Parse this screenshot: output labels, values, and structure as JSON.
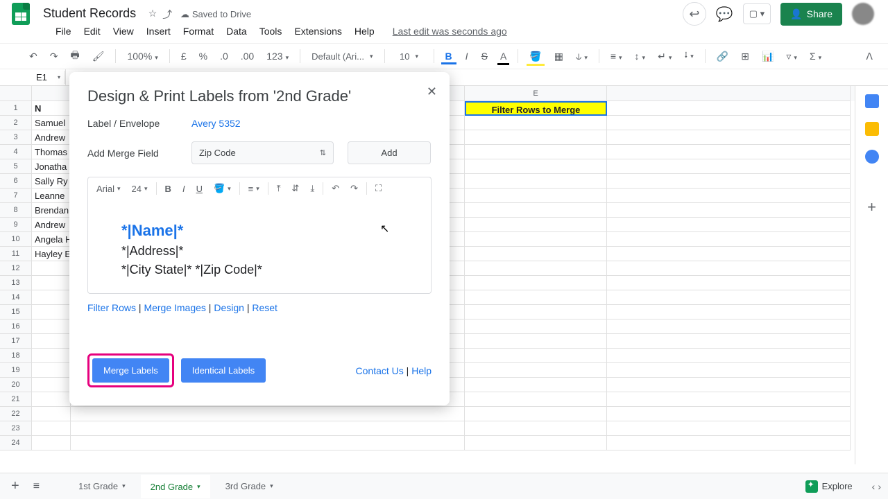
{
  "doc": {
    "title": "Student Records",
    "saved": "Saved to Drive",
    "last_edit": "Last edit was seconds ago"
  },
  "menu": {
    "file": "File",
    "edit": "Edit",
    "view": "View",
    "insert": "Insert",
    "format": "Format",
    "data": "Data",
    "tools": "Tools",
    "extensions": "Extensions",
    "help": "Help"
  },
  "share": "Share",
  "toolbar": {
    "zoom": "100%",
    "currency": "£",
    "percent": "%",
    "dec_dec": ".0",
    "dec_inc": ".00",
    "numfmt": "123",
    "font": "Default (Ari...",
    "size": "10",
    "bold": "B",
    "italic": "I",
    "strike": "S",
    "textA": "A",
    "sigma": "Σ"
  },
  "namebox": "E1",
  "columns": {
    "E": "E"
  },
  "cells": {
    "A1": "N",
    "filter_header": "Filter Rows to Merge",
    "names": [
      "Samuel",
      "Andrew",
      "Thomas",
      "Jonatha",
      "Sally Ry",
      "Leanne",
      "Brendan",
      "Andrew",
      "Angela H",
      "Hayley E"
    ]
  },
  "dialog": {
    "title": "Design & Print Labels from '2nd Grade'",
    "label_lbl": "Label / Envelope",
    "label_val": "Avery 5352",
    "merge_lbl": "Add Merge Field",
    "merge_sel": "Zip Code",
    "add": "Add",
    "editor": {
      "font": "Arial",
      "size": "24",
      "line1": "*|Name|*",
      "line2": "*|Address|*",
      "line3": "*|City State|* *|Zip Code|*"
    },
    "links": {
      "filter": "Filter Rows",
      "images": "Merge Images",
      "design": "Design",
      "reset": "Reset"
    },
    "merge_btn": "Merge Labels",
    "identical_btn": "Identical Labels",
    "contact": "Contact Us",
    "help": "Help"
  },
  "tabs": {
    "t1": "1st Grade",
    "t2": "2nd Grade",
    "t3": "3rd Grade"
  },
  "explore": "Explore"
}
